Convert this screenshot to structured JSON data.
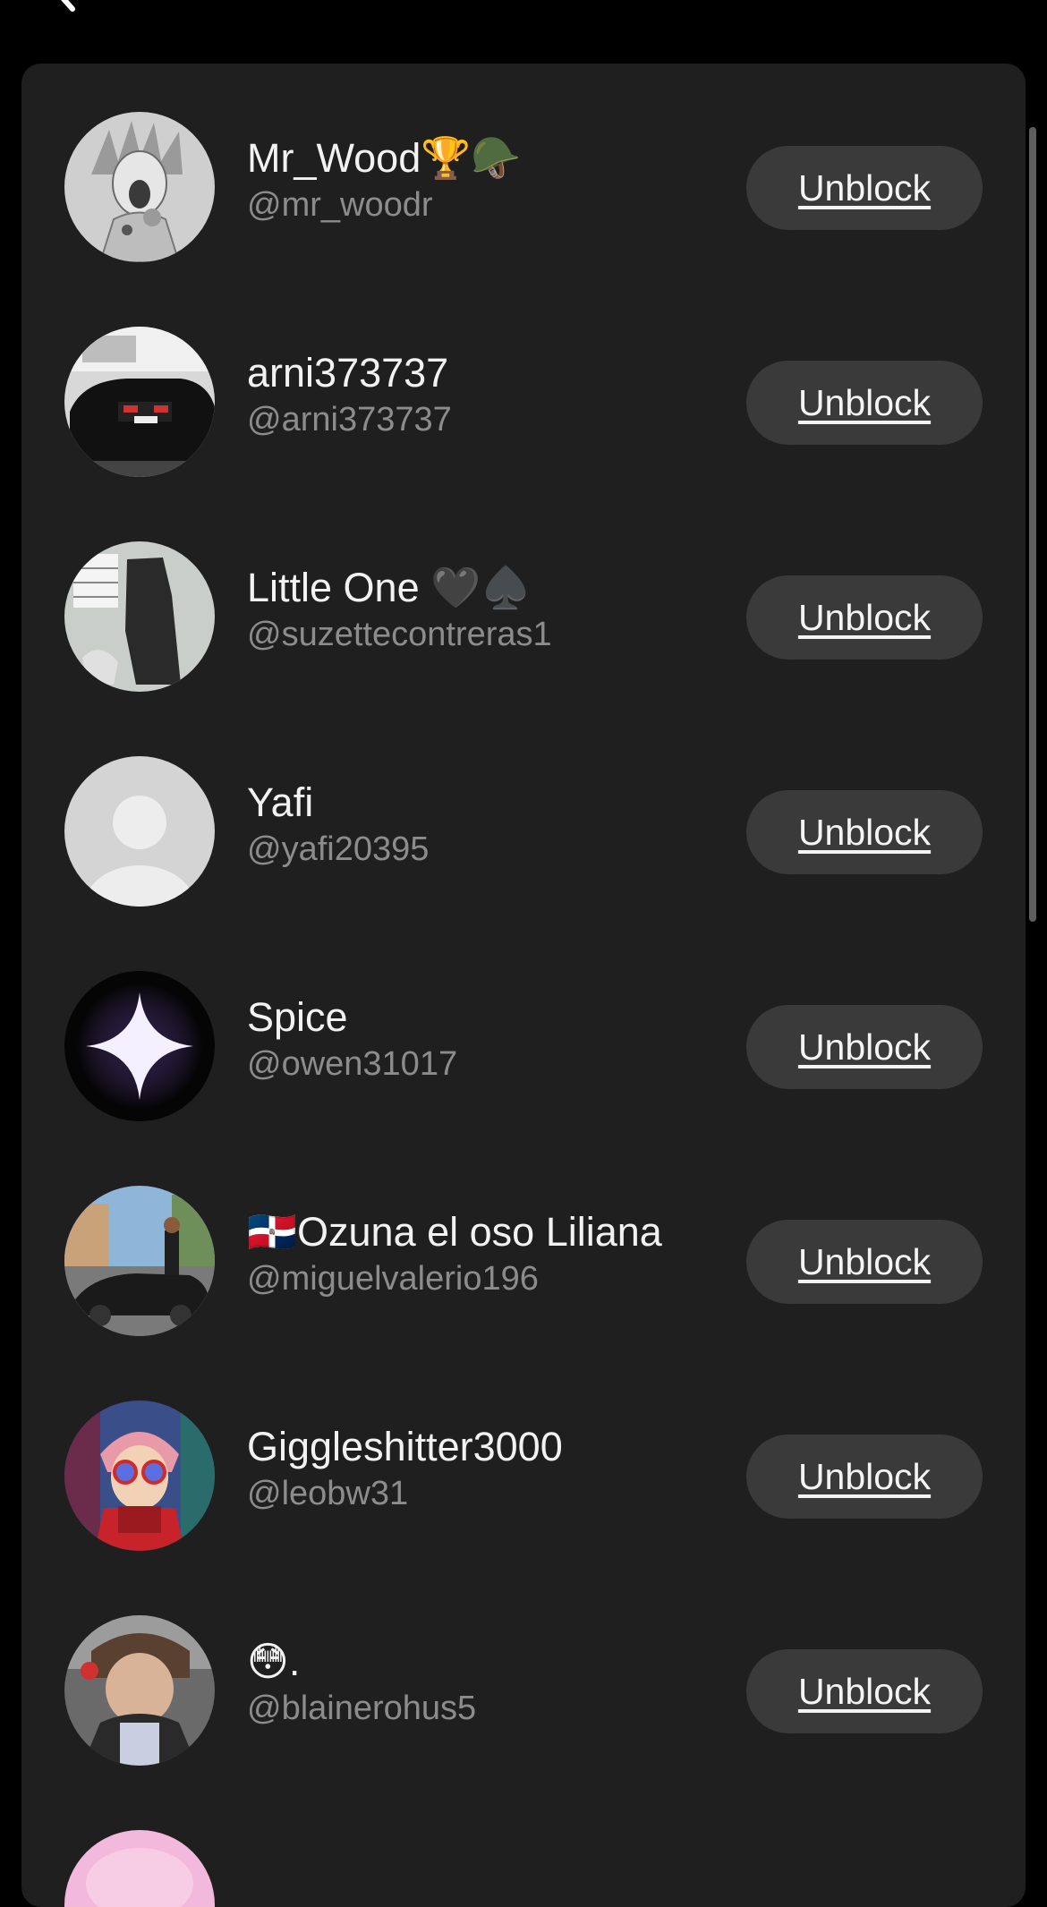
{
  "header": {
    "back_icon": "chevron-left-icon"
  },
  "blocked_users": [
    {
      "display_name": "Mr_Wood🏆🪖",
      "handle": "@mr_woodr",
      "button_label": "Unblock"
    },
    {
      "display_name": "arni373737",
      "handle": "@arni373737",
      "button_label": "Unblock"
    },
    {
      "display_name": "Little One 🖤♠️",
      "handle": "@suzettecontreras1",
      "button_label": "Unblock"
    },
    {
      "display_name": "Yafi",
      "handle": "@yafi20395",
      "button_label": "Unblock"
    },
    {
      "display_name": "Spice",
      "handle": "@owen31017",
      "button_label": "Unblock"
    },
    {
      "display_name": "🇩🇴Ozuna el oso Liliana",
      "handle": "@miguelvalerio196",
      "button_label": "Unblock"
    },
    {
      "display_name": "Giggleshitter3000",
      "handle": "@leobw31",
      "button_label": "Unblock"
    },
    {
      "display_name": "😳.",
      "handle": "@blainerohus5",
      "button_label": "Unblock"
    }
  ],
  "colors": {
    "background": "#000000",
    "panel": "#1f1f1f",
    "button": "#3a3a3a",
    "handle_text": "#8c8c8c"
  }
}
